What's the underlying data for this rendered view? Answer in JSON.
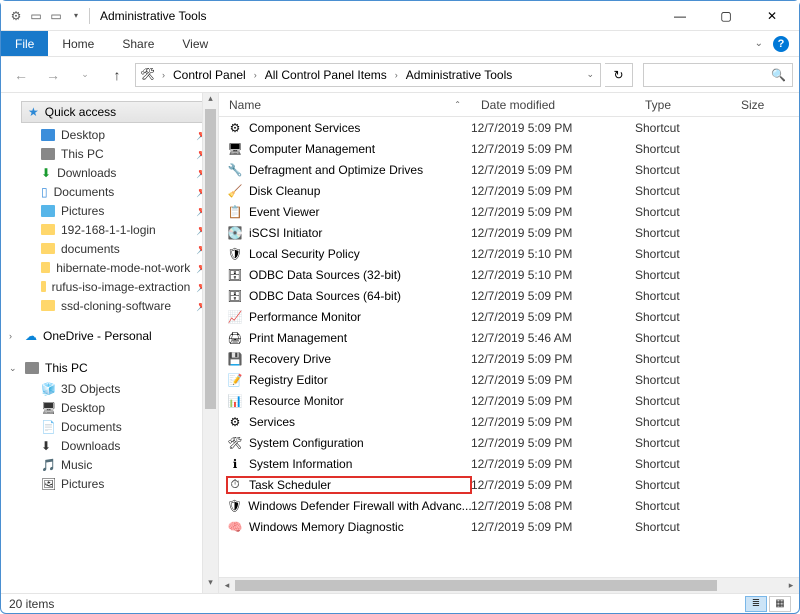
{
  "window": {
    "title": "Administrative Tools"
  },
  "menu": {
    "file": "File",
    "home": "Home",
    "share": "Share",
    "view": "View"
  },
  "breadcrumb": {
    "items": [
      "Control Panel",
      "All Control Panel Items",
      "Administrative Tools"
    ]
  },
  "sidebar": {
    "quick_access": {
      "label": "Quick access",
      "items": [
        {
          "label": "Desktop",
          "icon": "blue"
        },
        {
          "label": "This PC",
          "icon": "grey"
        },
        {
          "label": "Downloads",
          "icon": "arrow"
        },
        {
          "label": "Documents",
          "icon": "doc"
        },
        {
          "label": "Pictures",
          "icon": "pic"
        },
        {
          "label": "192-168-1-1-login",
          "icon": "folder"
        },
        {
          "label": "documents",
          "icon": "folder"
        },
        {
          "label": "hibernate-mode-not-work",
          "icon": "folder"
        },
        {
          "label": "rufus-iso-image-extraction",
          "icon": "folder"
        },
        {
          "label": "ssd-cloning-software",
          "icon": "folder"
        }
      ]
    },
    "onedrive": {
      "label": "OneDrive - Personal"
    },
    "this_pc": {
      "label": "This PC",
      "items": [
        {
          "label": "3D Objects"
        },
        {
          "label": "Desktop"
        },
        {
          "label": "Documents"
        },
        {
          "label": "Downloads"
        },
        {
          "label": "Music"
        },
        {
          "label": "Pictures"
        }
      ]
    }
  },
  "columns": {
    "name": "Name",
    "date": "Date modified",
    "type": "Type",
    "size": "Size"
  },
  "files": [
    {
      "name": "Component Services",
      "date": "12/7/2019 5:09 PM",
      "type": "Shortcut"
    },
    {
      "name": "Computer Management",
      "date": "12/7/2019 5:09 PM",
      "type": "Shortcut"
    },
    {
      "name": "Defragment and Optimize Drives",
      "date": "12/7/2019 5:09 PM",
      "type": "Shortcut"
    },
    {
      "name": "Disk Cleanup",
      "date": "12/7/2019 5:09 PM",
      "type": "Shortcut"
    },
    {
      "name": "Event Viewer",
      "date": "12/7/2019 5:09 PM",
      "type": "Shortcut"
    },
    {
      "name": "iSCSI Initiator",
      "date": "12/7/2019 5:09 PM",
      "type": "Shortcut"
    },
    {
      "name": "Local Security Policy",
      "date": "12/7/2019 5:10 PM",
      "type": "Shortcut"
    },
    {
      "name": "ODBC Data Sources (32-bit)",
      "date": "12/7/2019 5:10 PM",
      "type": "Shortcut"
    },
    {
      "name": "ODBC Data Sources (64-bit)",
      "date": "12/7/2019 5:09 PM",
      "type": "Shortcut"
    },
    {
      "name": "Performance Monitor",
      "date": "12/7/2019 5:09 PM",
      "type": "Shortcut"
    },
    {
      "name": "Print Management",
      "date": "12/7/2019 5:46 AM",
      "type": "Shortcut"
    },
    {
      "name": "Recovery Drive",
      "date": "12/7/2019 5:09 PM",
      "type": "Shortcut"
    },
    {
      "name": "Registry Editor",
      "date": "12/7/2019 5:09 PM",
      "type": "Shortcut"
    },
    {
      "name": "Resource Monitor",
      "date": "12/7/2019 5:09 PM",
      "type": "Shortcut"
    },
    {
      "name": "Services",
      "date": "12/7/2019 5:09 PM",
      "type": "Shortcut"
    },
    {
      "name": "System Configuration",
      "date": "12/7/2019 5:09 PM",
      "type": "Shortcut"
    },
    {
      "name": "System Information",
      "date": "12/7/2019 5:09 PM",
      "type": "Shortcut"
    },
    {
      "name": "Task Scheduler",
      "date": "12/7/2019 5:09 PM",
      "type": "Shortcut",
      "highlight": true
    },
    {
      "name": "Windows Defender Firewall with Advanc...",
      "date": "12/7/2019 5:08 PM",
      "type": "Shortcut"
    },
    {
      "name": "Windows Memory Diagnostic",
      "date": "12/7/2019 5:09 PM",
      "type": "Shortcut"
    }
  ],
  "status": {
    "count": "20 items"
  }
}
